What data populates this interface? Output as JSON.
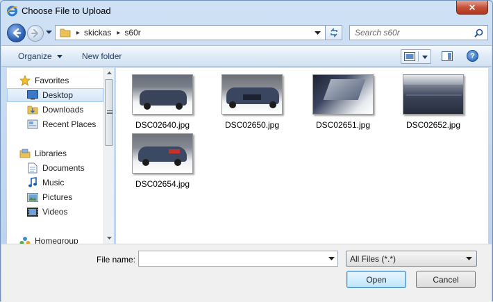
{
  "window": {
    "title": "Choose File to Upload",
    "close_label": "✕"
  },
  "address": {
    "separator": "▸",
    "crumbs": [
      "skickas",
      "s60r"
    ],
    "search_placeholder": "Search s60r"
  },
  "toolbar": {
    "organize": "Organize",
    "new_folder": "New folder",
    "help": "?"
  },
  "nav": {
    "favorites": "Favorites",
    "desktop": "Desktop",
    "downloads": "Downloads",
    "recent_places": "Recent Places",
    "libraries": "Libraries",
    "documents": "Documents",
    "music": "Music",
    "pictures": "Pictures",
    "videos": "Videos",
    "homegroup": "Homegroup"
  },
  "files": [
    {
      "name": "DSC02640.jpg"
    },
    {
      "name": "DSC02650.jpg"
    },
    {
      "name": "DSC02651.jpg"
    },
    {
      "name": "DSC02652.jpg"
    },
    {
      "name": "DSC02654.jpg"
    }
  ],
  "footer": {
    "file_name_label": "File name:",
    "file_name_value": "",
    "filter_selected": "All Files (*.*)",
    "open": "Open",
    "cancel": "Cancel"
  },
  "colors": {
    "selection": "#d5e6f8",
    "accent": "#2e62b5",
    "close": "#c4533a"
  }
}
